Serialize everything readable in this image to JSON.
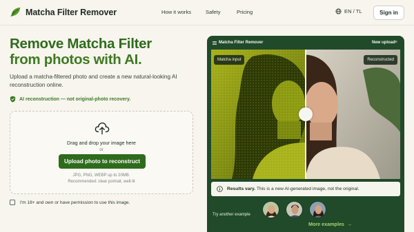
{
  "header": {
    "brand": "Matcha Filter Remover",
    "nav": [
      "How it works",
      "Safety",
      "Pricing"
    ],
    "language": "EN / TL",
    "signin_label": "Sign in"
  },
  "hero": {
    "title_line1": "Remove Matcha Filter",
    "title_line2": "from photos with AI.",
    "subtitle": "Upload a matcha-filtered photo and create a new natural-looking AI reconstruction online.",
    "note": "AI reconstruction — not original-photo recovery."
  },
  "upload": {
    "title": "Drag and drop your image here",
    "or": "or",
    "button_label": "Upload photo to reconstruct",
    "hint_formats": "JPG, PNG, WEBP up to 20MB.",
    "hint_recommended": "Recommended: clear portrait, well-lit"
  },
  "consent": {
    "label": "I'm 18+ and own or have permission to use this image."
  },
  "panel": {
    "title": "Matcha Filter Remover",
    "new_upload": "New upload",
    "close_glyph": "×",
    "left_tag": "Matcha input",
    "right_tag": "Reconstructed",
    "results_strong": "Results vary.",
    "results_rest": " This is a new AI-generated image, not the original.",
    "try_label": "Try another example",
    "more_label": "More examples",
    "more_arrow": "→"
  },
  "colors": {
    "brand_green": "#2f6b1c",
    "panel_green": "#204a2a",
    "link_green": "#a6d36e"
  },
  "icons": {
    "logo": "leaf-icon",
    "language": "globe-icon",
    "upload": "cloud-upload-icon",
    "note": "shield-check-icon",
    "info": "info-icon",
    "menu": "menu-icon"
  }
}
